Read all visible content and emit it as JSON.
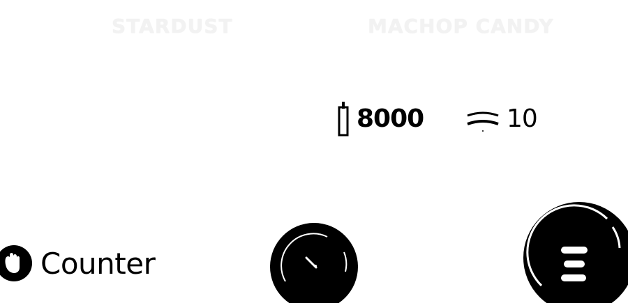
{
  "labels": {
    "stardust": "STARDUST",
    "candy": "MACHOP CANDY"
  },
  "cost": {
    "stardust": "8000",
    "candy": "10"
  },
  "actions": {
    "counter_label": "Counter"
  },
  "icons": {
    "stardust": "stardust-icon",
    "candy": "candy-icon",
    "counter": "hand-icon",
    "dial": "dial-icon",
    "menu": "menu-icon"
  },
  "colors": {
    "foreground": "#000000",
    "background": "#ffffff",
    "faint_label": "#f2f2f2"
  }
}
